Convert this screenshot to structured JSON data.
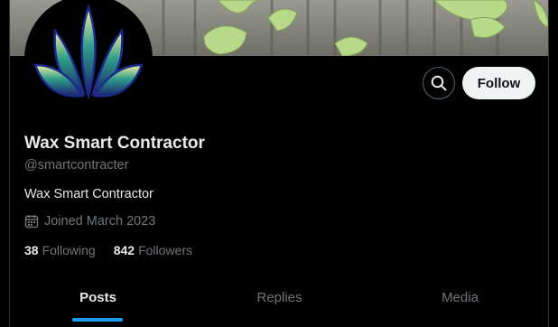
{
  "profile": {
    "display_name": "Wax Smart Contractor",
    "handle": "@smartcontracter",
    "bio": "Wax Smart Contractor",
    "joined": "Joined March 2023"
  },
  "actions": {
    "follow_label": "Follow",
    "search_icon": "search-icon"
  },
  "stats": {
    "following": {
      "count": "38",
      "label": "Following"
    },
    "followers": {
      "count": "842",
      "label": "Followers"
    }
  },
  "tabs": [
    {
      "label": "Posts",
      "active": true
    },
    {
      "label": "Replies",
      "active": false
    },
    {
      "label": "Media",
      "active": false
    }
  ],
  "colors": {
    "background": "#000000",
    "text_primary": "#e7e9ea",
    "text_secondary": "#71767b",
    "accent": "#1d9bf0",
    "follow_button_bg": "#eff3f4"
  },
  "icons": {
    "calendar": "calendar-icon",
    "avatar_logo": "leaf-logo-icon"
  }
}
